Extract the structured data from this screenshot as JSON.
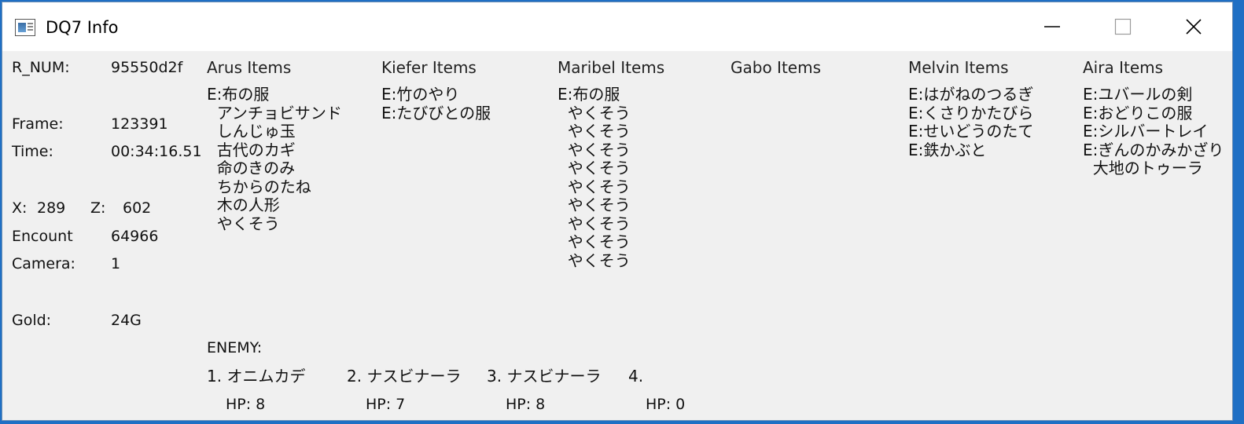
{
  "window": {
    "title": "DQ7 Info",
    "icon": "app-window-icon"
  },
  "stats": {
    "r_num_label": "R_NUM:",
    "r_num_value": "95550d2f",
    "frame_label": "Frame:",
    "frame_value": "123391",
    "time_label": "Time:",
    "time_value": "00:34:16.51",
    "x_label": "X:",
    "x_value": "289",
    "z_label": "Z:",
    "z_value": "602",
    "encount_label": "Encount",
    "encount_value": "64966",
    "camera_label": "Camera:",
    "camera_value": "1",
    "gold_label": "Gold:",
    "gold_value": "24G"
  },
  "party": [
    {
      "header": "Arus Items",
      "items": [
        "E:布の服",
        "  アンチョビサンド",
        "  しんじゅ玉",
        "  古代のカギ",
        "  命のきのみ",
        "  ちからのたね",
        "  木の人形",
        "  やくそう"
      ]
    },
    {
      "header": "Kiefer Items",
      "items": [
        "E:竹のやり",
        "E:たびびとの服"
      ]
    },
    {
      "header": "Maribel Items",
      "items": [
        "E:布の服",
        "  やくそう",
        "  やくそう",
        "  やくそう",
        "  やくそう",
        "  やくそう",
        "  やくそう",
        "  やくそう",
        "  やくそう",
        "  やくそう"
      ]
    },
    {
      "header": "Gabo Items",
      "items": []
    },
    {
      "header": "Melvin Items",
      "items": [
        "E:はがねのつるぎ",
        "E:くさりかたびら",
        "E:せいどうのたて",
        "E:鉄かぶと"
      ]
    },
    {
      "header": "Aira Items",
      "items": [
        "E:ユバールの剣",
        "E:おどりこの服",
        "E:シルバートレイ",
        "E:ぎんのかみかざり",
        "  大地のトゥーラ"
      ]
    }
  ],
  "enemy": {
    "label": "ENEMY:",
    "list": [
      {
        "name": "1. オニムカデ",
        "hp": "HP: 8"
      },
      {
        "name": "2. ナスビナーラ",
        "hp": "HP: 7"
      },
      {
        "name": "3. ナスビナーラ",
        "hp": "HP: 8"
      },
      {
        "name": "4.",
        "hp": "HP: 0"
      }
    ]
  }
}
